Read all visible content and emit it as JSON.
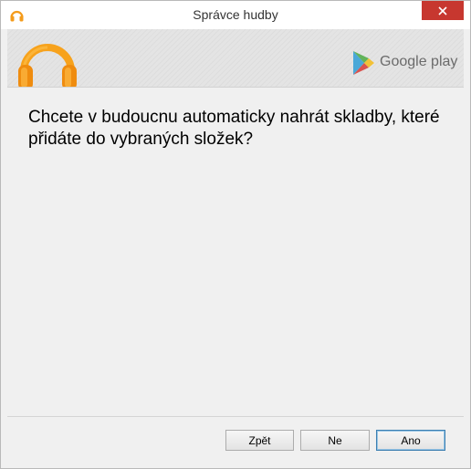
{
  "window": {
    "title": "Správce hudby"
  },
  "titlebar": {
    "close_icon": "close-icon",
    "app_icon": "headphones-icon"
  },
  "banner": {
    "logo_icon": "headphones-logo",
    "brand_text": "Google play",
    "brand_icon": "google-play-triangle-icon"
  },
  "content": {
    "question": "Chcete v budoucnu automaticky nahrát skladby, které přidáte do vybraných složek?"
  },
  "buttons": {
    "back_label": "Zpět",
    "no_label": "Ne",
    "yes_label": "Ano"
  },
  "colors": {
    "accent_orange": "#f49b1b",
    "close_red": "#c7372f",
    "default_button_border": "#3c7fb1"
  }
}
